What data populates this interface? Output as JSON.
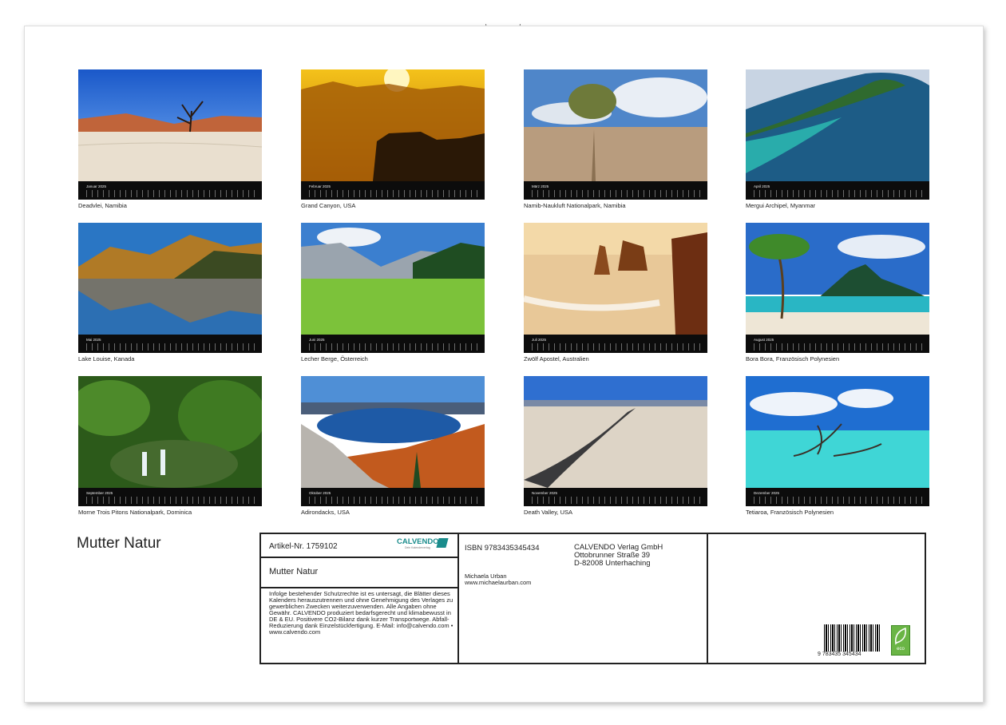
{
  "calendar_title": "Mutter Natur",
  "months": [
    {
      "month": "Januar 2025",
      "caption": "Deadvlei, Namibia"
    },
    {
      "month": "Februar 2025",
      "caption": "Grand Canyon, USA"
    },
    {
      "month": "März 2025",
      "caption": "Namib-Naukluft Nationalpark, Namibia"
    },
    {
      "month": "April 2025",
      "caption": "Mergui Archipel, Myanmar"
    },
    {
      "month": "Mai 2025",
      "caption": "Lake Louise, Kanada"
    },
    {
      "month": "Juni 2025",
      "caption": "Lecher Berge, Österreich"
    },
    {
      "month": "Juli 2025",
      "caption": "Zwölf Apostel, Australien"
    },
    {
      "month": "August 2025",
      "caption": "Bora Bora, Französisch Polynesien"
    },
    {
      "month": "September 2025",
      "caption": "Morne Trois Pitons Nationalpark, Dominica"
    },
    {
      "month": "Oktober 2025",
      "caption": "Adirondacks, USA"
    },
    {
      "month": "November 2025",
      "caption": "Death Valley, USA"
    },
    {
      "month": "Dezember 2025",
      "caption": "Tetiaroa, Französisch Polynesien"
    }
  ],
  "info": {
    "article": "Artikel-Nr. 1759102",
    "logo": "CALVENDO",
    "logo_sub": "Dein Kalenderverlag",
    "title": "Mutter Natur",
    "legal": "Infolge bestehender Schutzrechte ist es untersagt, die Blätter dieses Kalenders herauszutrennen und ohne Genehmigung des Verlages zu gewerblichen Zwecken weiterzuverwenden. Alle Angaben ohne Gewähr. CALVENDO produziert bedarfsgerecht und klimabewusst in DE & EU. Positivere CO2-Bilanz dank kurzer Transportwege. Abfall-Reduzierung dank Einzelstückfertigung. E-Mail: info@calvendo.com • www.calvendo.com",
    "isbn": "ISBN 9783435345434",
    "publisher_name": "CALVENDO Verlag GmbH",
    "publisher_street": "Ottobrunner Straße 39",
    "publisher_city": "D-82008 Unterhaching",
    "author": "Michaela Urban",
    "author_url": "www.michaelaurban.com",
    "barcode_number": "9 783435 345434",
    "eco_label": "eco"
  },
  "colors": {
    "calendar_strip": "#0c0c0c",
    "eco_green": "#6ab545",
    "calvendo_teal": "#1a8c8c"
  }
}
